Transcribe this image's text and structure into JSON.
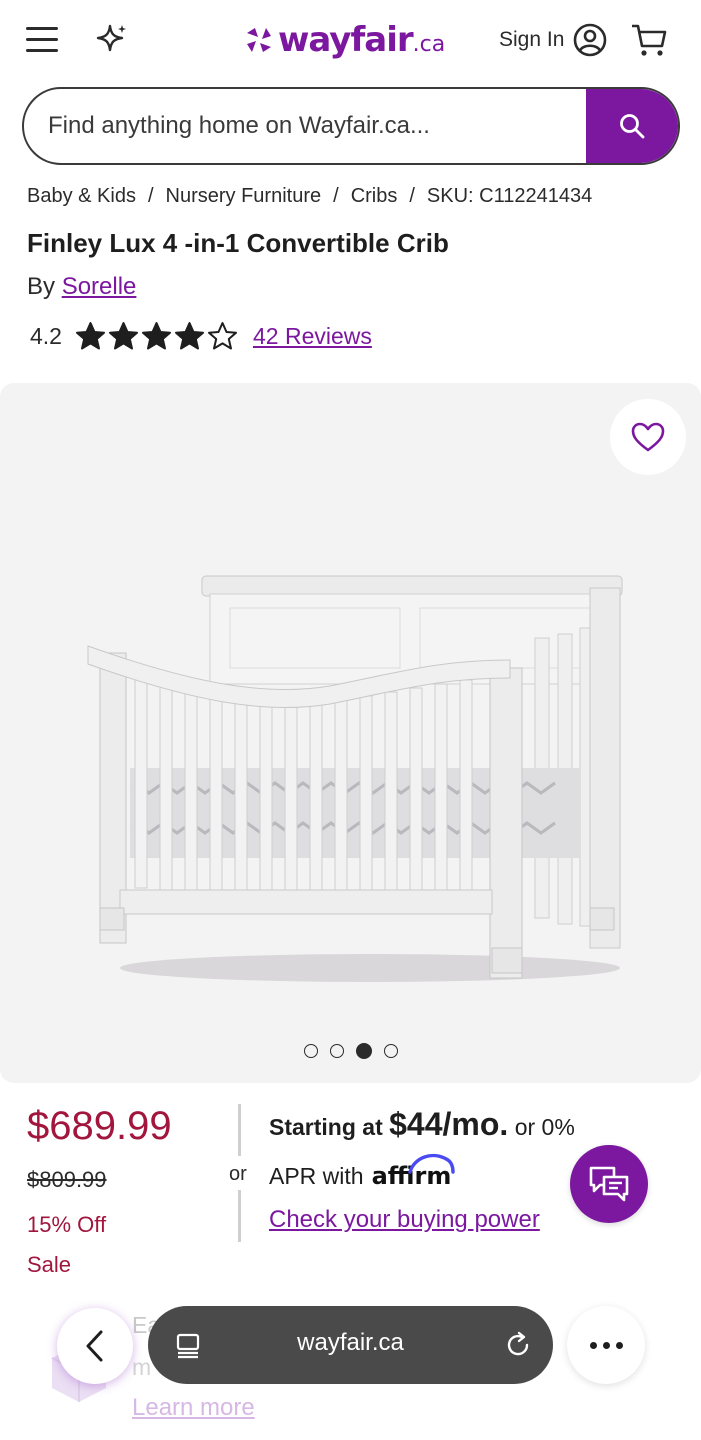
{
  "header": {
    "logo_text": "wayfair",
    "logo_suffix": ".ca",
    "signin_label": "Sign In",
    "icons": [
      "menu-icon",
      "sparkle-icon",
      "account-icon",
      "cart-icon"
    ]
  },
  "search": {
    "placeholder": "Find anything home on Wayfair.ca..."
  },
  "breadcrumb": {
    "items": [
      "Baby & Kids",
      "Nursery Furniture",
      "Cribs"
    ],
    "sku": "SKU: C112241434"
  },
  "product": {
    "title": "Finley Lux 4 -in-1 Convertible Crib",
    "by_label": "By",
    "brand": "Sorelle",
    "rating": "4.2",
    "rating_value": 4.2,
    "rating_max": 5,
    "reviews_label": "42 Reviews"
  },
  "gallery": {
    "image_count": 4,
    "active_index": 2
  },
  "pricing": {
    "price": "$689.99",
    "old_price": "$809.99",
    "discount": "15% Off",
    "sale": "Sale",
    "or_label": "or",
    "starting_label": "Starting at",
    "monthly": "$44/mo.",
    "or_apr": "or 0%",
    "apr_label": "APR with",
    "affirm_label": "affirm",
    "check_power": "Check your buying power"
  },
  "promo": {
    "line1": "Ea",
    "line2": "m",
    "learn_more": "Learn more"
  },
  "browser": {
    "url": "wayfair.ca"
  },
  "colors": {
    "brand": "#7b189f",
    "price": "#a2163e",
    "text": "#1e1e1e"
  }
}
